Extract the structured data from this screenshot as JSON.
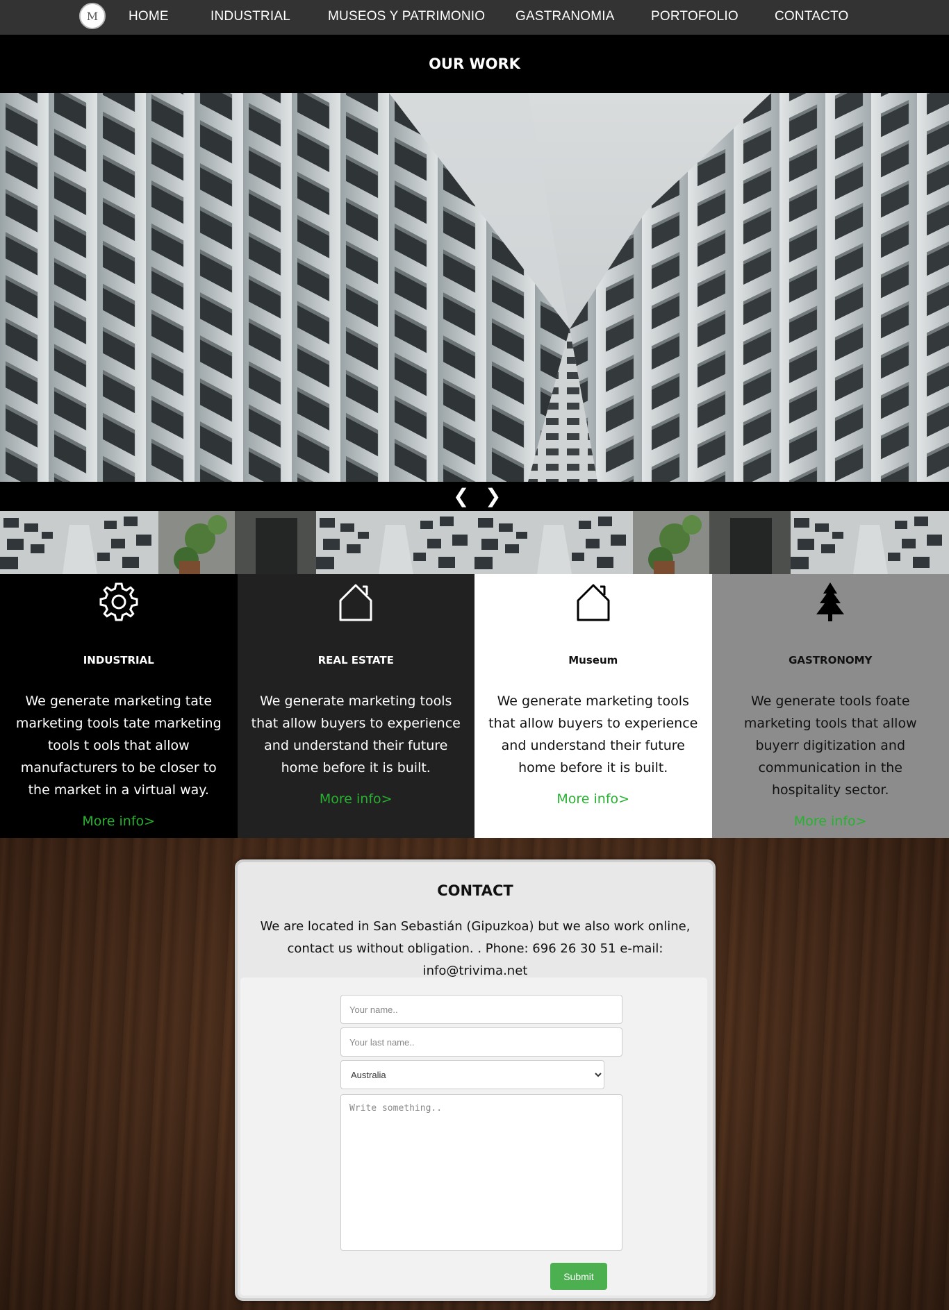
{
  "nav": {
    "logo_letter": "M",
    "items": [
      {
        "label": "HOME"
      },
      {
        "label": "INDUSTRIAL"
      },
      {
        "label": "MUSEOS Y PATRIMONIO"
      },
      {
        "label": "GASTRANOMIA"
      },
      {
        "label": "PORTOFOLIO"
      },
      {
        "label": "CONTACTO"
      }
    ]
  },
  "section": {
    "title": "OUR WORK"
  },
  "slider": {
    "prev_label": "❮",
    "next_label": "❯",
    "thumbnails": [
      "building",
      "plants-door",
      "building",
      "building",
      "plants-door",
      "building"
    ]
  },
  "services": [
    {
      "icon": "gear-icon",
      "title": "INDUSTRIAL",
      "text": "We generate marketing tate marketing tools tate marketing tools t ools that allow manufacturers to be closer to the market in a virtual way.",
      "link": "More info>",
      "bg": "#000000",
      "fg": "#ffffff"
    },
    {
      "icon": "house-icon",
      "title": "REAL ESTATE",
      "text": "We generate marketing tools that allow buyers to experience and understand their future home before it is built.",
      "link": "More info>",
      "bg": "#212121",
      "fg": "#ffffff"
    },
    {
      "icon": "house-icon",
      "title": "Museum",
      "text": "We generate marketing tools that allow buyers to experience and understand their future home before it is built.",
      "link": "More info>",
      "bg": "#ffffff",
      "fg": "#111111"
    },
    {
      "icon": "tree-icon",
      "title": "GASTRONOMY",
      "text": "We generate tools foate marketing tools that allow buyerr digitization and communication in the hospitality sector.",
      "link": "More info>",
      "bg": "#8c8c8c",
      "fg": "#111111"
    }
  ],
  "contact": {
    "title": "CONTACT",
    "intro": "We are located in San Sebastián (Gipuzkoa) but we also work online, contact us without obligation. . Phone: 696 26 30 51 e-mail: info@trivima.net",
    "first_name_placeholder": "Your name..",
    "last_name_placeholder": "Your last name..",
    "country_selected": "Australia",
    "message_placeholder": "Write something..",
    "submit_label": "Submit"
  },
  "colors": {
    "nav_bg": "#333333",
    "link_green": "#27b130",
    "submit_green": "#4caf50"
  }
}
